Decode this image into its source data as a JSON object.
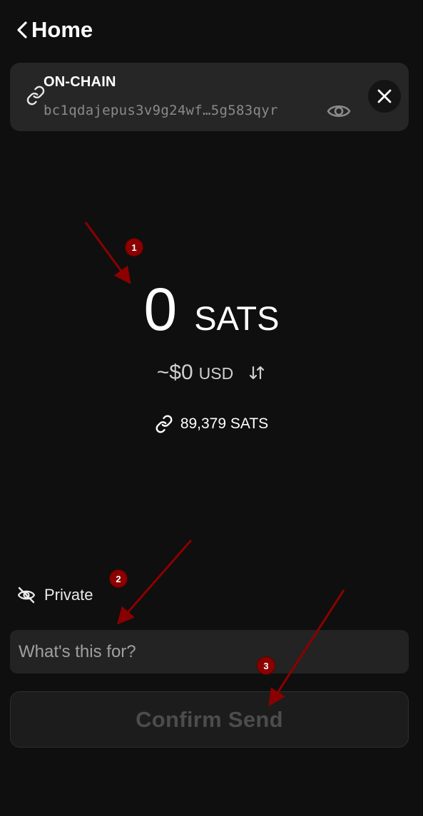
{
  "header": {
    "title": "Home"
  },
  "destination": {
    "type": "ON-CHAIN",
    "address": "bc1qdajepus3v9g24wf…5g583qyr"
  },
  "amount": {
    "value": "0",
    "unit": "SATS",
    "fiat_value": "~$0",
    "fiat_unit": "USD"
  },
  "balance": {
    "text": "89,379 SATS"
  },
  "privacy": {
    "label": "Private"
  },
  "note": {
    "placeholder": "What's this for?",
    "value": ""
  },
  "confirm": {
    "label": "Confirm Send",
    "enabled": false
  },
  "annotations": [
    {
      "label": "1"
    },
    {
      "label": "2"
    },
    {
      "label": "3"
    }
  ],
  "colors": {
    "background": "#0f0f0f",
    "card": "#262626",
    "annotation": "#8b0000",
    "disabled_text": "#4c4c4c"
  },
  "icons": [
    "chevron-left-icon",
    "link-icon",
    "eye-icon",
    "close-icon",
    "swap-vertical-icon",
    "eye-off-icon"
  ]
}
